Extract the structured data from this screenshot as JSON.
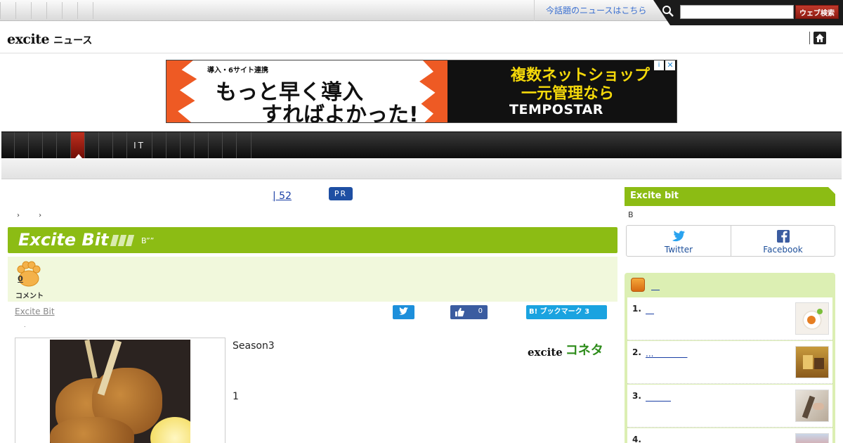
{
  "topbar": {
    "news_link": "今話題のニュースはこちら",
    "search_placeholder": "",
    "search_button": "ウェブ検索"
  },
  "logo": {
    "brand": "excite",
    "suffix": "ニュース"
  },
  "ad": {
    "left_small": "導入・6サイト連携",
    "left_line1": "もっと早く導入",
    "left_line2": "すればよかった!",
    "right_line1": "複数ネットショップ",
    "right_line2": "一元管理なら",
    "right_line3": "TEMPOSTAR",
    "info": "i",
    "close": "✕"
  },
  "catnav": {
    "active_label": "IT"
  },
  "main": {
    "top_link": "| 52",
    "pr_badge": "PR",
    "crumbs": "› ›",
    "section_title": "Excite Bit",
    "section_sub": "B””",
    "comment_count": "0",
    "comment_label": "コメント",
    "source": "Excite Bit",
    "dot": ".",
    "like_count": "0",
    "hatena_label": "B! ブックマーク 3",
    "article_title": "Season3",
    "article_num": "1",
    "konete_brand": "excite",
    "konete_label": "コネタ"
  },
  "sidebar": {
    "head_title": "Excite bit",
    "b_text": "B",
    "twitter_label": "Twitter",
    "facebook_label": "Facebook",
    "ranking_title": "＿",
    "ranking": [
      {
        "no": "1.",
        "title": "＿"
      },
      {
        "no": "2.",
        "title": "...＿＿＿＿"
      },
      {
        "no": "3.",
        "title": "＿＿＿"
      },
      {
        "no": "4.",
        "title": ""
      }
    ]
  },
  "colors": {
    "brand_green": "#8cbc14",
    "panel_green": "#f1f8dc",
    "nav_active": "#c0301f",
    "link_blue": "#1a3fa5"
  }
}
